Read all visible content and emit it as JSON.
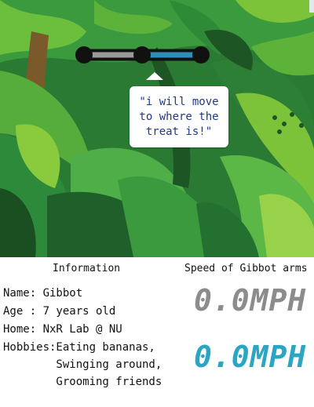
{
  "scene": {
    "bubble_lines": [
      "\"i will move",
      "to where the",
      "treat is!\""
    ]
  },
  "info": {
    "heading": "Information",
    "name": "Name: Gibbot",
    "age": "Age : 7 years old",
    "home": "Home: NxR Lab @ NU",
    "hobbies": [
      "Hobbies:Eating bananas,",
      "        Swinging around,",
      "        Grooming friends"
    ]
  },
  "speed": {
    "heading": "Speed of Gibbot arms",
    "arm_1": "0.0MPH",
    "arm_2": "0.0MPH"
  },
  "colors": {
    "jungle_dark": "#1f5b27",
    "leaf_mid": "#3a9a3a",
    "leaf_light": "#7cc33a",
    "arm_left": "#9a9a9a",
    "arm_right": "#2e8fb8",
    "speed_gray": "#8c8c8c",
    "speed_blue": "#2aa6c3",
    "bubble_text": "#1f3a8c"
  }
}
